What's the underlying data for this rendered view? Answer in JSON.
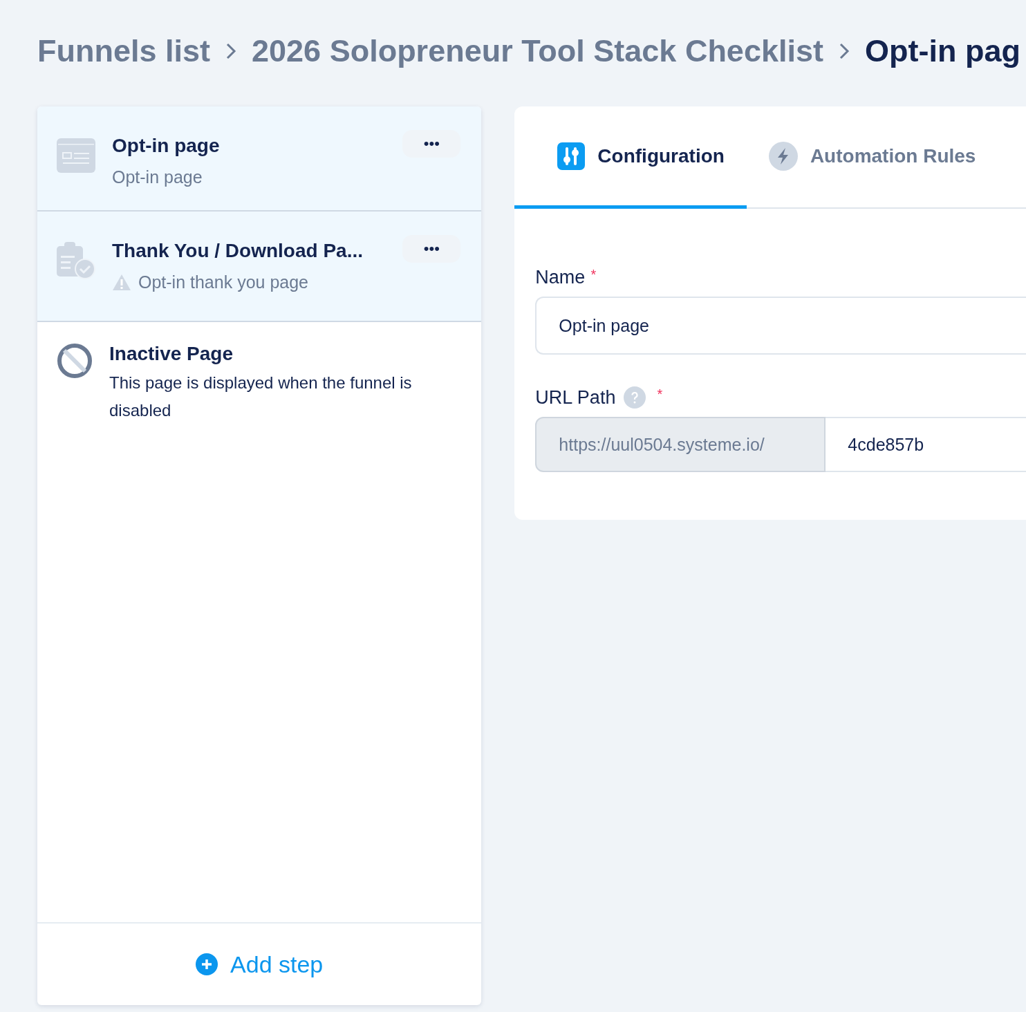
{
  "breadcrumb": [
    {
      "label": "Funnels list",
      "current": false
    },
    {
      "label": "2026 Solopreneur Tool Stack Checklist",
      "current": false
    },
    {
      "label": "Opt-in pag",
      "current": true
    }
  ],
  "steps": [
    {
      "kind": "optin",
      "title": "Opt-in page",
      "subtitle": "Opt-in page",
      "warning": false,
      "menu": "•••"
    },
    {
      "kind": "thankyou",
      "title": "Thank You / Download Pa...",
      "subtitle": "Opt-in thank you page",
      "warning": true,
      "menu": "•••"
    }
  ],
  "inactive_page": {
    "title": "Inactive Page",
    "description": "This page is displayed when the funnel is disabled"
  },
  "add_step": "Add step",
  "tabs": [
    {
      "kind": "configuration",
      "label": "Configuration",
      "selected": true
    },
    {
      "kind": "automation",
      "label": "Automation Rules",
      "selected": false
    }
  ],
  "form": {
    "name_label": "Name",
    "name_required": "*",
    "name_value": "Opt-in page",
    "url_label": "URL Path",
    "url_required": "*",
    "url_prefix": "https://uul0504.systeme.io/",
    "url_value": "4cde857b"
  }
}
